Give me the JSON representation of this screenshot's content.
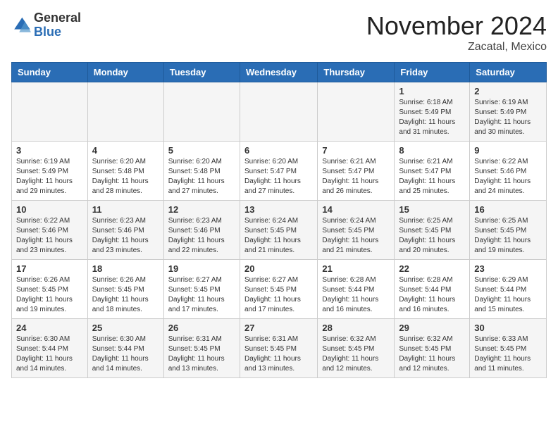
{
  "logo": {
    "general": "General",
    "blue": "Blue"
  },
  "header": {
    "month": "November 2024",
    "location": "Zacatal, Mexico"
  },
  "weekdays": [
    "Sunday",
    "Monday",
    "Tuesday",
    "Wednesday",
    "Thursday",
    "Friday",
    "Saturday"
  ],
  "weeks": [
    [
      {
        "day": "",
        "info": ""
      },
      {
        "day": "",
        "info": ""
      },
      {
        "day": "",
        "info": ""
      },
      {
        "day": "",
        "info": ""
      },
      {
        "day": "",
        "info": ""
      },
      {
        "day": "1",
        "info": "Sunrise: 6:18 AM\nSunset: 5:49 PM\nDaylight: 11 hours and 31 minutes."
      },
      {
        "day": "2",
        "info": "Sunrise: 6:19 AM\nSunset: 5:49 PM\nDaylight: 11 hours and 30 minutes."
      }
    ],
    [
      {
        "day": "3",
        "info": "Sunrise: 6:19 AM\nSunset: 5:49 PM\nDaylight: 11 hours and 29 minutes."
      },
      {
        "day": "4",
        "info": "Sunrise: 6:20 AM\nSunset: 5:48 PM\nDaylight: 11 hours and 28 minutes."
      },
      {
        "day": "5",
        "info": "Sunrise: 6:20 AM\nSunset: 5:48 PM\nDaylight: 11 hours and 27 minutes."
      },
      {
        "day": "6",
        "info": "Sunrise: 6:20 AM\nSunset: 5:47 PM\nDaylight: 11 hours and 27 minutes."
      },
      {
        "day": "7",
        "info": "Sunrise: 6:21 AM\nSunset: 5:47 PM\nDaylight: 11 hours and 26 minutes."
      },
      {
        "day": "8",
        "info": "Sunrise: 6:21 AM\nSunset: 5:47 PM\nDaylight: 11 hours and 25 minutes."
      },
      {
        "day": "9",
        "info": "Sunrise: 6:22 AM\nSunset: 5:46 PM\nDaylight: 11 hours and 24 minutes."
      }
    ],
    [
      {
        "day": "10",
        "info": "Sunrise: 6:22 AM\nSunset: 5:46 PM\nDaylight: 11 hours and 23 minutes."
      },
      {
        "day": "11",
        "info": "Sunrise: 6:23 AM\nSunset: 5:46 PM\nDaylight: 11 hours and 23 minutes."
      },
      {
        "day": "12",
        "info": "Sunrise: 6:23 AM\nSunset: 5:46 PM\nDaylight: 11 hours and 22 minutes."
      },
      {
        "day": "13",
        "info": "Sunrise: 6:24 AM\nSunset: 5:45 PM\nDaylight: 11 hours and 21 minutes."
      },
      {
        "day": "14",
        "info": "Sunrise: 6:24 AM\nSunset: 5:45 PM\nDaylight: 11 hours and 21 minutes."
      },
      {
        "day": "15",
        "info": "Sunrise: 6:25 AM\nSunset: 5:45 PM\nDaylight: 11 hours and 20 minutes."
      },
      {
        "day": "16",
        "info": "Sunrise: 6:25 AM\nSunset: 5:45 PM\nDaylight: 11 hours and 19 minutes."
      }
    ],
    [
      {
        "day": "17",
        "info": "Sunrise: 6:26 AM\nSunset: 5:45 PM\nDaylight: 11 hours and 19 minutes."
      },
      {
        "day": "18",
        "info": "Sunrise: 6:26 AM\nSunset: 5:45 PM\nDaylight: 11 hours and 18 minutes."
      },
      {
        "day": "19",
        "info": "Sunrise: 6:27 AM\nSunset: 5:45 PM\nDaylight: 11 hours and 17 minutes."
      },
      {
        "day": "20",
        "info": "Sunrise: 6:27 AM\nSunset: 5:45 PM\nDaylight: 11 hours and 17 minutes."
      },
      {
        "day": "21",
        "info": "Sunrise: 6:28 AM\nSunset: 5:44 PM\nDaylight: 11 hours and 16 minutes."
      },
      {
        "day": "22",
        "info": "Sunrise: 6:28 AM\nSunset: 5:44 PM\nDaylight: 11 hours and 16 minutes."
      },
      {
        "day": "23",
        "info": "Sunrise: 6:29 AM\nSunset: 5:44 PM\nDaylight: 11 hours and 15 minutes."
      }
    ],
    [
      {
        "day": "24",
        "info": "Sunrise: 6:30 AM\nSunset: 5:44 PM\nDaylight: 11 hours and 14 minutes."
      },
      {
        "day": "25",
        "info": "Sunrise: 6:30 AM\nSunset: 5:44 PM\nDaylight: 11 hours and 14 minutes."
      },
      {
        "day": "26",
        "info": "Sunrise: 6:31 AM\nSunset: 5:45 PM\nDaylight: 11 hours and 13 minutes."
      },
      {
        "day": "27",
        "info": "Sunrise: 6:31 AM\nSunset: 5:45 PM\nDaylight: 11 hours and 13 minutes."
      },
      {
        "day": "28",
        "info": "Sunrise: 6:32 AM\nSunset: 5:45 PM\nDaylight: 11 hours and 12 minutes."
      },
      {
        "day": "29",
        "info": "Sunrise: 6:32 AM\nSunset: 5:45 PM\nDaylight: 11 hours and 12 minutes."
      },
      {
        "day": "30",
        "info": "Sunrise: 6:33 AM\nSunset: 5:45 PM\nDaylight: 11 hours and 11 minutes."
      }
    ]
  ]
}
